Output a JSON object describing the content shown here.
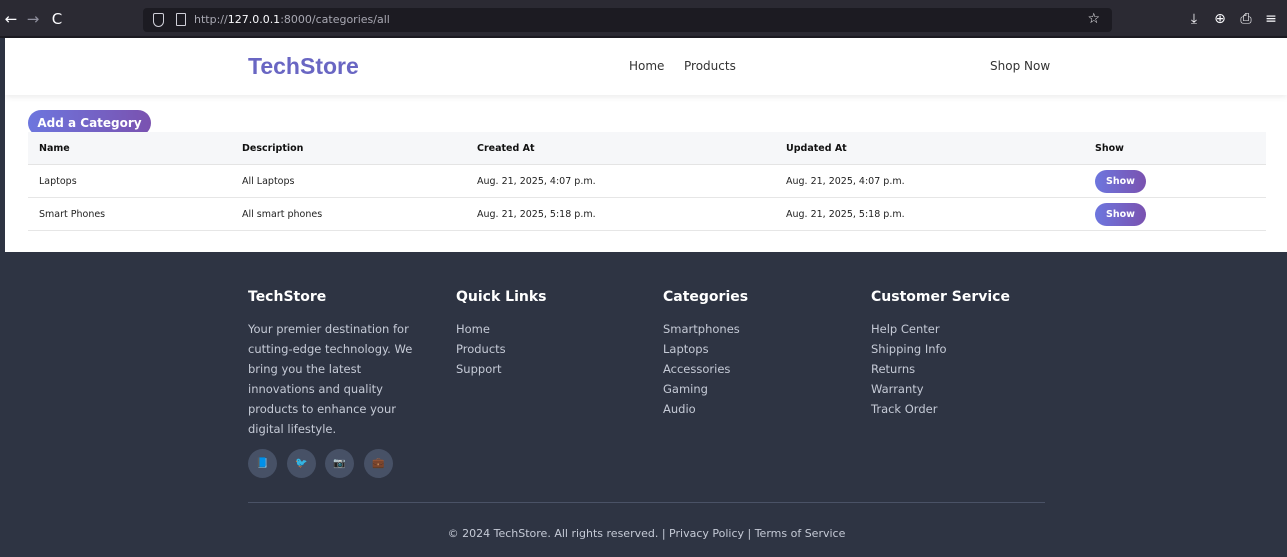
{
  "browser": {
    "back": "←",
    "forward": "→",
    "reload": "C",
    "url_prefix": "http://",
    "url_host": "127.0.0.1",
    "url_rest": ":8000/categories/all",
    "star": "☆",
    "tools": [
      "⤓",
      "⊕",
      "⎙",
      "≡"
    ]
  },
  "header": {
    "logo": "TechStore",
    "nav": [
      "Home",
      "Products"
    ],
    "cta": "Shop Now"
  },
  "main": {
    "add_button": "Add a Category",
    "table": {
      "headers": [
        "Name",
        "Description",
        "Created At",
        "Updated At",
        "Show"
      ],
      "rows": [
        {
          "name": "Laptops",
          "description": "All Laptops",
          "created": "Aug. 21, 2025, 4:07 p.m.",
          "updated": "Aug. 21, 2025, 4:07 p.m.",
          "action": "Show"
        },
        {
          "name": "Smart Phones",
          "description": "All smart phones",
          "created": "Aug. 21, 2025, 5:18 p.m.",
          "updated": "Aug. 21, 2025, 5:18 p.m.",
          "action": "Show"
        }
      ]
    }
  },
  "footer": {
    "about": {
      "title": "TechStore",
      "text": "Your premier destination for cutting-edge technology. We bring you the latest innovations and quality products to enhance your digital lifestyle."
    },
    "quick_links": {
      "title": "Quick Links",
      "items": [
        "Home",
        "Products",
        "Support"
      ]
    },
    "categories": {
      "title": "Categories",
      "items": [
        "Smartphones",
        "Laptops",
        "Accessories",
        "Gaming",
        "Audio"
      ]
    },
    "customer_service": {
      "title": "Customer Service",
      "items": [
        "Help Center",
        "Shipping Info",
        "Returns",
        "Warranty",
        "Track Order"
      ]
    },
    "socials": [
      {
        "icon": "facebook-icon",
        "glyph": "📘"
      },
      {
        "icon": "twitter-icon",
        "glyph": "🐦"
      },
      {
        "icon": "instagram-icon",
        "glyph": "📷"
      },
      {
        "icon": "linkedin-icon",
        "glyph": "💼"
      }
    ],
    "copyright": "© 2024 TechStore. All rights reserved. | Privacy Policy | Terms of Service"
  },
  "colors": {
    "brand": "#6966c3",
    "button_gradient_start": "#6d76de",
    "button_gradient_end": "#7a52b0",
    "footer_bg": "#2e3443"
  }
}
